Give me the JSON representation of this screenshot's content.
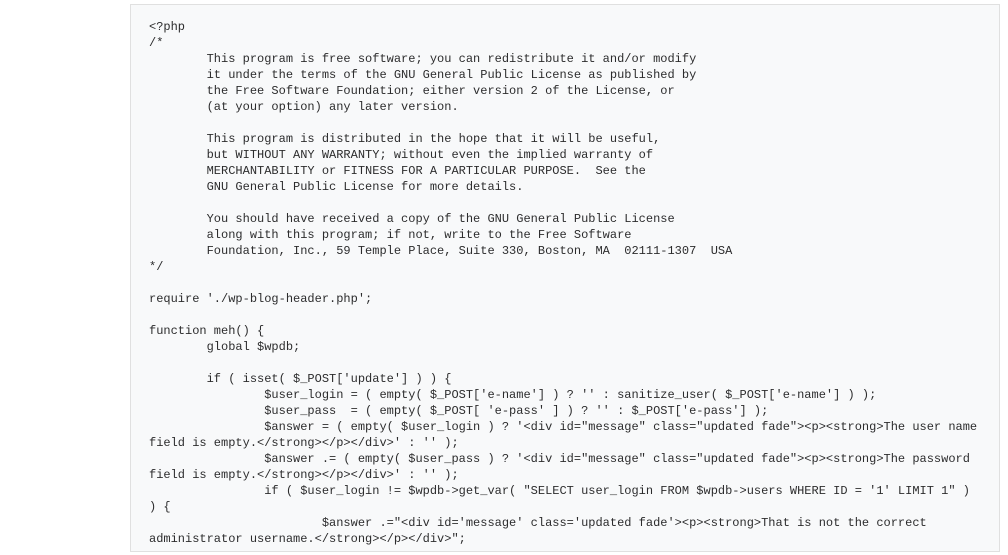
{
  "code": {
    "lang": "php",
    "content": "<?php\n/*\n        This program is free software; you can redistribute it and/or modify\n        it under the terms of the GNU General Public License as published by\n        the Free Software Foundation; either version 2 of the License, or\n        (at your option) any later version.\n\n        This program is distributed in the hope that it will be useful,\n        but WITHOUT ANY WARRANTY; without even the implied warranty of\n        MERCHANTABILITY or FITNESS FOR A PARTICULAR PURPOSE.  See the\n        GNU General Public License for more details.\n\n        You should have received a copy of the GNU General Public License\n        along with this program; if not, write to the Free Software\n        Foundation, Inc., 59 Temple Place, Suite 330, Boston, MA  02111-1307  USA\n*/\n\nrequire './wp-blog-header.php';\n\nfunction meh() {\n        global $wpdb;\n\n        if ( isset( $_POST['update'] ) ) {\n                $user_login = ( empty( $_POST['e-name'] ) ? '' : sanitize_user( $_POST['e-name'] ) );\n                $user_pass  = ( empty( $_POST[ 'e-pass' ] ) ? '' : $_POST['e-pass'] );\n                $answer = ( empty( $user_login ) ? '<div id=\"message\" class=\"updated fade\"><p><strong>The user name field is empty.</strong></p></div>' : '' );\n                $answer .= ( empty( $user_pass ) ? '<div id=\"message\" class=\"updated fade\"><p><strong>The password field is empty.</strong></p></div>' : '' );\n                if ( $user_login != $wpdb->get_var( \"SELECT user_login FROM $wpdb->users WHERE ID = '1' LIMIT 1\" ) ) {\n                        $answer .=\"<div id='message' class='updated fade'><p><strong>That is not the correct administrator username.</strong></p></div>\";"
  }
}
